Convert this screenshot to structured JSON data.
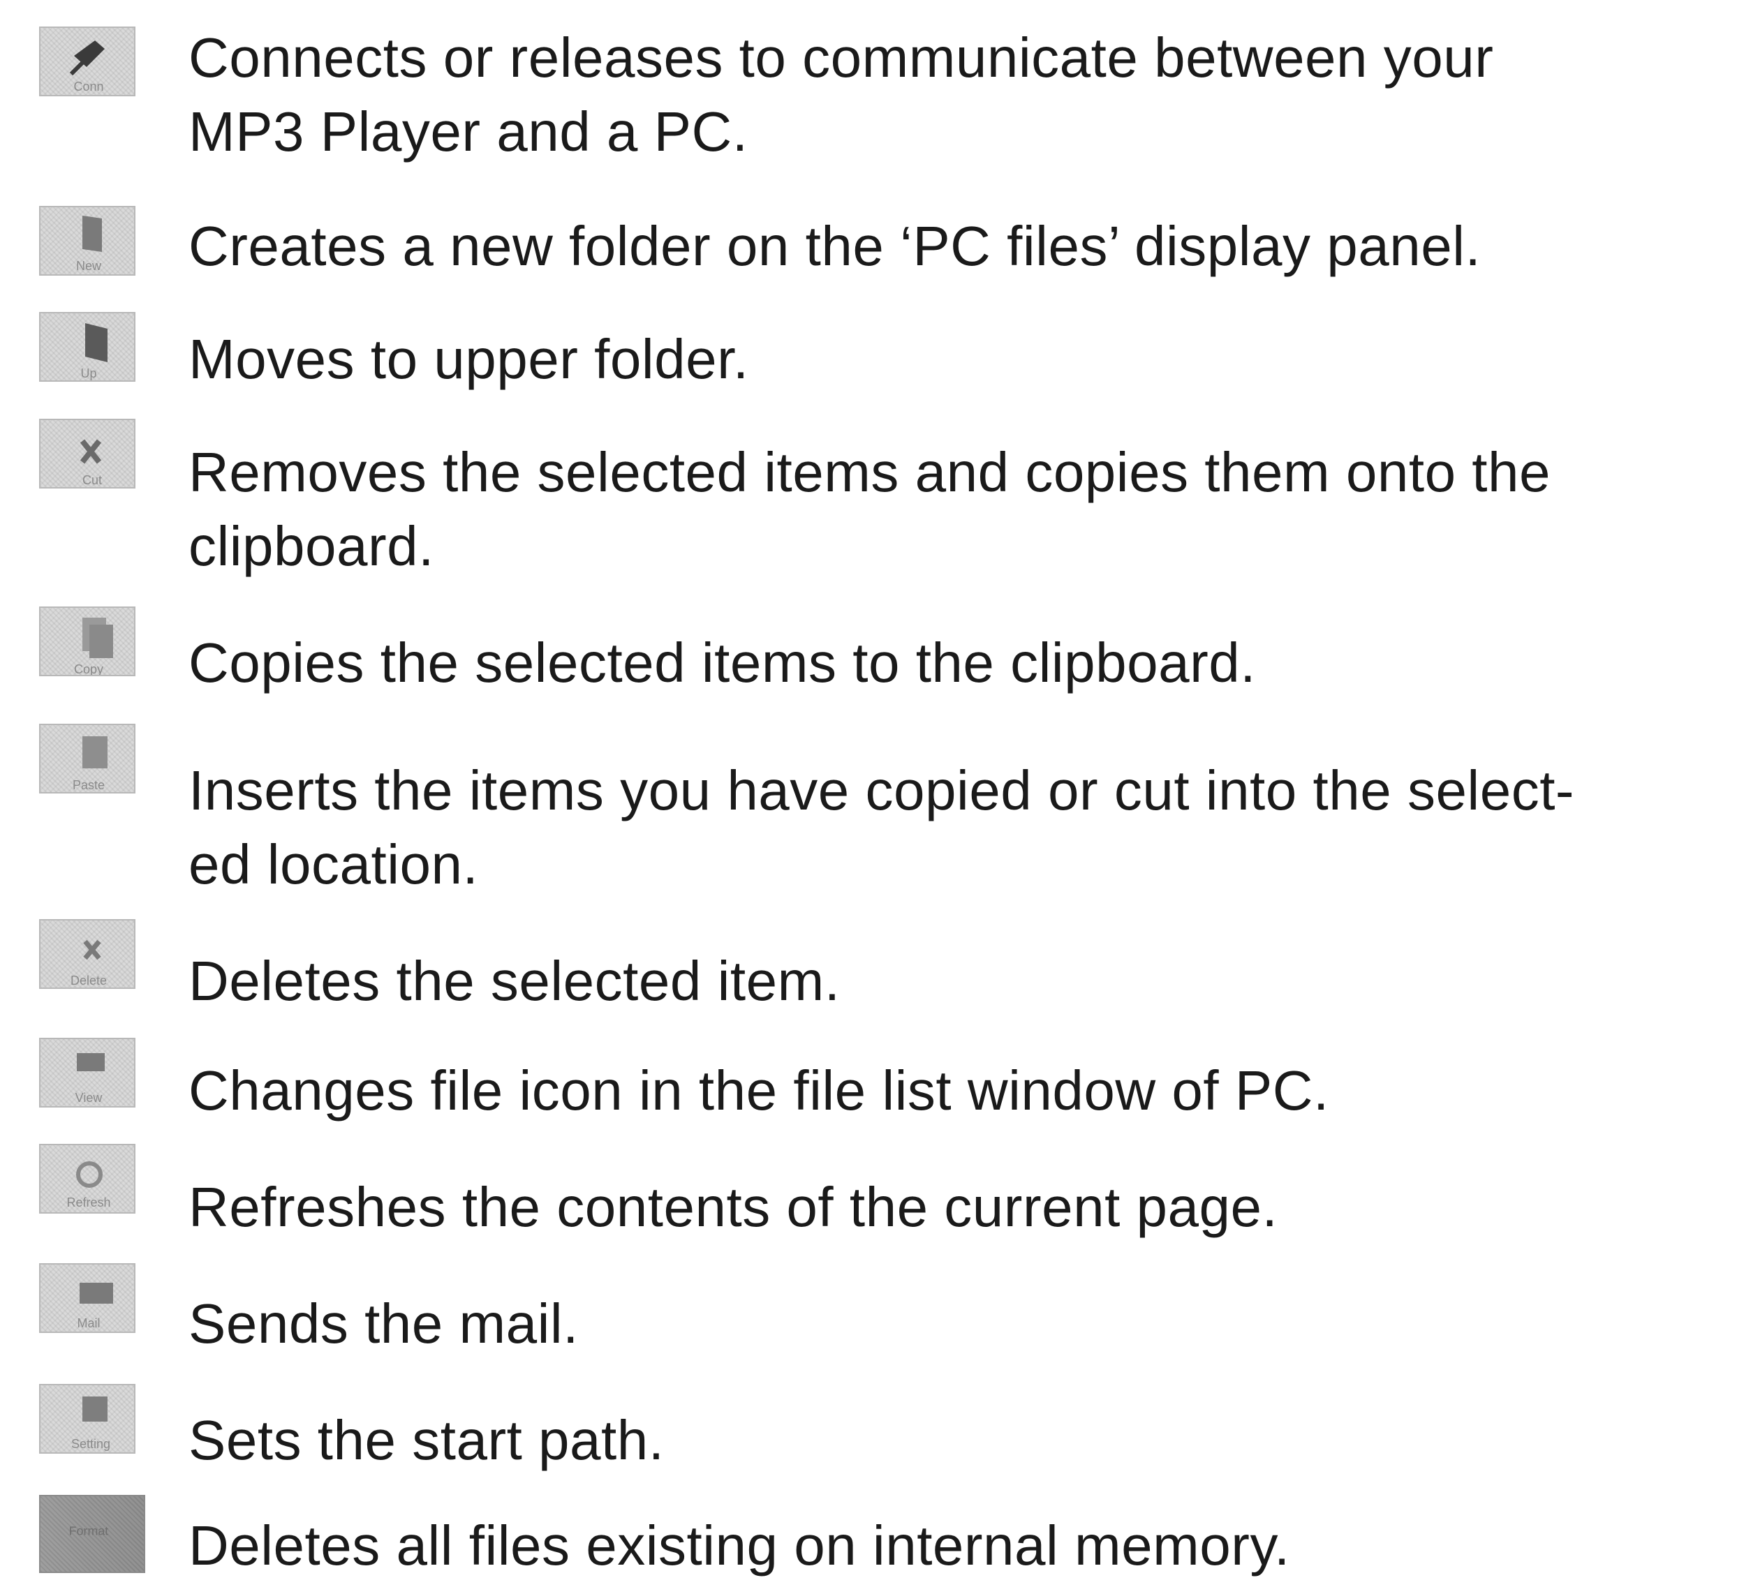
{
  "toolbar_legend": [
    {
      "icon": "connect-icon",
      "text": "Connects or releases to communicate between your\nMP3 Player and a PC."
    },
    {
      "icon": "new-folder-icon",
      "text": "Creates a new folder on the ‘PC files’ display panel."
    },
    {
      "icon": "upper-folder-icon",
      "text": "Moves to upper folder."
    },
    {
      "icon": "cut-icon",
      "text": "Removes the selected items and copies them onto the\nclipboard."
    },
    {
      "icon": "copy-icon",
      "text": "Copies the selected items to the clipboard."
    },
    {
      "icon": "paste-icon",
      "text": "Inserts the items you have copied or cut into the select-\ned location."
    },
    {
      "icon": "delete-icon",
      "text": "Deletes the selected item."
    },
    {
      "icon": "view-icon",
      "text": "Changes  file icon in the file list window of PC."
    },
    {
      "icon": "refresh-icon",
      "text": "Refreshes the contents of the current page."
    },
    {
      "icon": "mail-icon",
      "text": "Sends the mail."
    },
    {
      "icon": "setting-icon",
      "text": "Sets the start path."
    },
    {
      "icon": "format-icon",
      "text": "Deletes all files existing on internal memory."
    }
  ]
}
